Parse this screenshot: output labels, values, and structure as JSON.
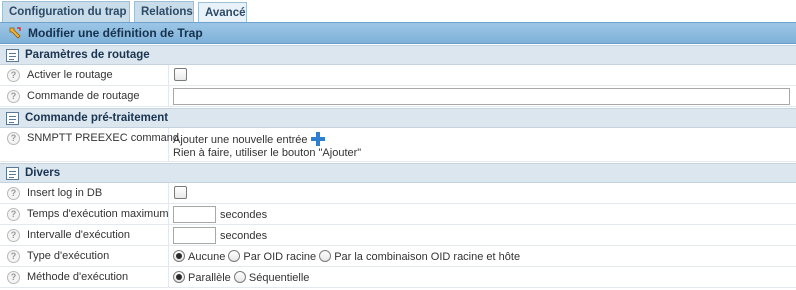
{
  "tabs": [
    {
      "label": "Configuration du trap"
    },
    {
      "label": "Relations"
    },
    {
      "label": "Avancé"
    }
  ],
  "header": {
    "title": "Modifier une définition de Trap"
  },
  "sections": {
    "routing": {
      "title": "Paramètres de routage"
    },
    "preexec": {
      "title": "Commande pré-traitement"
    },
    "misc": {
      "title": "Divers"
    }
  },
  "fields": {
    "enable_routing": {
      "label": "Activer le routage",
      "checked": false
    },
    "routing_command": {
      "label": "Commande de routage",
      "value": ""
    },
    "snmptt_preexec": {
      "label": "SNMPTT PREEXEC command",
      "add_text": "Ajouter une nouvelle entrée",
      "empty_text": "Rien à faire, utiliser le bouton \"Ajouter\""
    },
    "insert_log": {
      "label": "Insert log in DB",
      "checked": false
    },
    "max_exec_time": {
      "label": "Temps d'exécution maximum",
      "value": "",
      "unit": "secondes"
    },
    "exec_interval": {
      "label": "Intervalle d'exécution",
      "value": "",
      "unit": "secondes"
    },
    "exec_type": {
      "label": "Type d'exécution",
      "options": [
        "Aucune",
        "Par OID racine",
        "Par la combinaison OID racine et hôte"
      ],
      "selected": "Aucune"
    },
    "exec_method": {
      "label": "Méthode d'exécution",
      "options": [
        "Parallèle",
        "Séquentielle"
      ],
      "selected": "Parallèle"
    }
  },
  "help_glyph": "?",
  "colors": {
    "header_bg": "#8dbde0",
    "section_bg": "#dbe6ef",
    "tab_bg": "#c9dcea",
    "add_icon": "#2e7fd0"
  }
}
